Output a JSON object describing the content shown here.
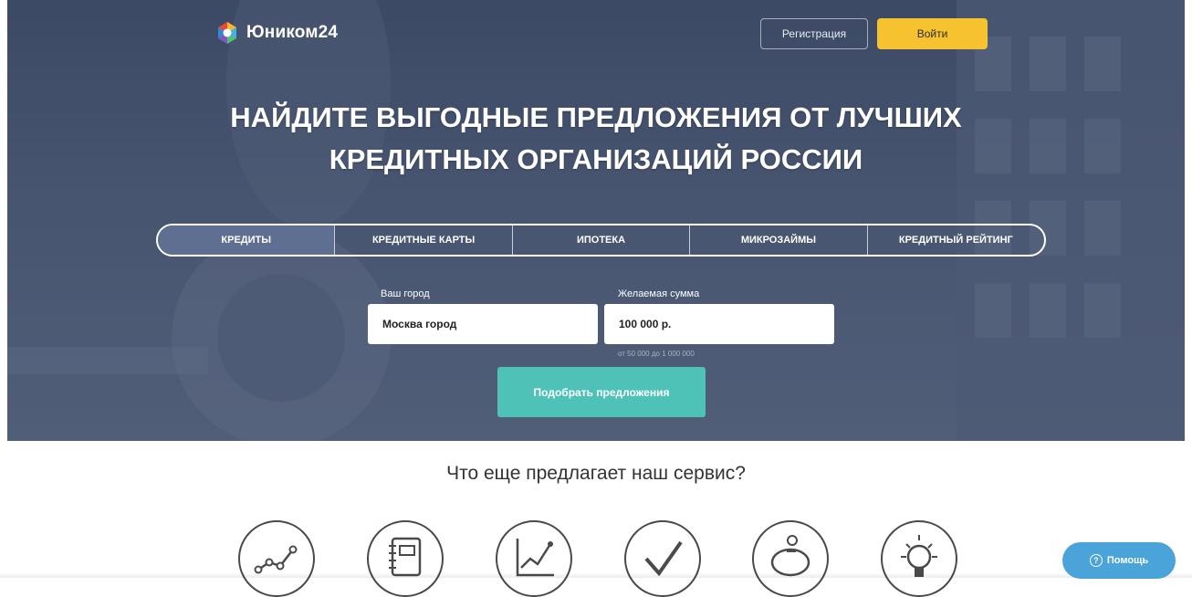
{
  "header": {
    "logo_text": "Юником24",
    "register_label": "Регистрация",
    "login_label": "Войти"
  },
  "hero": {
    "title_line1": "НАЙДИТЕ ВЫГОДНЫЕ ПРЕДЛОЖЕНИЯ ОТ ЛУЧШИХ",
    "title_line2": "КРЕДИТНЫХ ОРГАНИЗАЦИЙ РОССИИ"
  },
  "tabs": [
    {
      "label": "КРЕДИТЫ",
      "active": true
    },
    {
      "label": "КРЕДИТНЫЕ КАРТЫ",
      "active": false
    },
    {
      "label": "ИПОТЕКА",
      "active": false
    },
    {
      "label": "МИКРОЗАЙМЫ",
      "active": false
    },
    {
      "label": "КРЕДИТНЫЙ РЕЙТИНГ",
      "active": false
    }
  ],
  "form": {
    "city_label": "Ваш город",
    "city_value": "Москва город",
    "amount_label": "Желаемая сумма",
    "amount_value": "100 000 р.",
    "amount_hint": "от 50 000 до 1 000 000",
    "submit_label": "Подобрать предложения"
  },
  "services": {
    "title": "Что еще предлагает наш сервис?",
    "icons": [
      "trend-line-icon",
      "notebook-icon",
      "growth-chart-icon",
      "checkmark-icon",
      "piggy-bank-icon",
      "lightbulb-icon"
    ]
  },
  "help": {
    "label": "Помощь"
  },
  "colors": {
    "hero_bg": "#4a5772",
    "login_button": "#f6c22f",
    "submit_button": "#4fc2b8",
    "help_button": "#4aa3d9",
    "active_tab": "#5f6f91"
  }
}
